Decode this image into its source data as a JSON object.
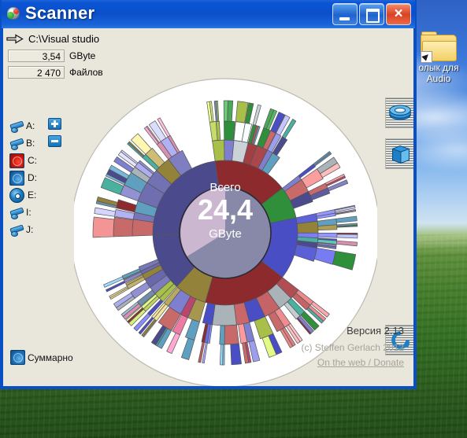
{
  "desktop": {
    "shortcut": {
      "label": "олык для\nAudio",
      "icon": "folder-shortcut-icon"
    }
  },
  "window": {
    "title": "Scanner",
    "icon": "globe-icon",
    "buttons": {
      "minimize": "minimize-button",
      "maximize": "maximize-button",
      "close": "×"
    }
  },
  "path": {
    "icon": "arrow-right-icon",
    "value": "C:\\Visual studio"
  },
  "stats": [
    {
      "value": "3,54",
      "unit": "GByte"
    },
    {
      "value": "2 470",
      "unit": "Файлов"
    }
  ],
  "drives": [
    {
      "letter": "A:",
      "type": "floppy"
    },
    {
      "letter": "B:",
      "type": "floppy"
    },
    {
      "letter": "C:",
      "type": "hd-red"
    },
    {
      "letter": "D:",
      "type": "hd-blue"
    },
    {
      "letter": "E:",
      "type": "cd"
    },
    {
      "letter": "I:",
      "type": "floppy"
    },
    {
      "letter": "J:",
      "type": "floppy"
    }
  ],
  "zoom_buttons": {
    "plus": "+",
    "minus": "−"
  },
  "tools": [
    {
      "name": "recycle-bin-button",
      "icon": "recycle-bin-icon"
    },
    {
      "name": "folder-up-button",
      "icon": "folder-icon"
    },
    {
      "name": "refresh-button",
      "icon": "refresh-icon"
    }
  ],
  "summary": {
    "label": "Суммарно",
    "icon": "hd-blue-icon"
  },
  "footer": {
    "version": "Версия 2.13",
    "copyright": "(c) Steffen Gerlach 2012",
    "link": "On the web / Donate"
  },
  "chart_data": {
    "type": "pie",
    "title": "",
    "center_label_top": "Всего",
    "center_label_value": "24,4",
    "center_label_unit": "GByte",
    "total_gbyte": 24.4,
    "legend_position": "none",
    "rings": [
      {
        "ring": 0,
        "r_inner": 0,
        "r_outer": 58,
        "note": "center disc"
      },
      {
        "ring": 1,
        "r_inner": 58,
        "r_outer": 92
      },
      {
        "ring": 2,
        "r_inner": 92,
        "r_outer": 118
      },
      {
        "ring": 3,
        "r_inner": 118,
        "r_outer": 142
      },
      {
        "ring": 4,
        "r_inner": 142,
        "r_outer": 168
      }
    ],
    "series": [
      {
        "name": "slate-blue",
        "start_angle": 268,
        "end_angle": 352,
        "value": 5.7,
        "color": "#4a4a8c"
      },
      {
        "name": "dark-red",
        "start_angle": 352,
        "end_angle": 52,
        "value": 4.7,
        "color": "#8d2a2e"
      },
      {
        "name": "green",
        "start_angle": 52,
        "end_angle": 78,
        "value": 1.8,
        "color": "#2f8f3a"
      },
      {
        "name": "royal-blue",
        "start_angle": 78,
        "end_angle": 128,
        "value": 3.4,
        "color": "#4a4ec4"
      },
      {
        "name": "dark-red-2",
        "start_angle": 128,
        "end_angle": 196,
        "value": 4.6,
        "color": "#8d2a2e"
      },
      {
        "name": "olive",
        "start_angle": 196,
        "end_angle": 222,
        "value": 1.8,
        "color": "#93823a"
      },
      {
        "name": "slate-blue-2",
        "start_angle": 222,
        "end_angle": 268,
        "value": 3.1,
        "color": "#4a4a8c"
      }
    ],
    "palette": [
      "#4a4a8c",
      "#8d2a2e",
      "#2f8f3a",
      "#4a4ec4",
      "#93823a",
      "#6f8fa8",
      "#4ab0a0",
      "#b8466f",
      "#aab3b8",
      "#cbd3d8",
      "#7f7fd0",
      "#a8bf4a",
      "#c96a6a",
      "#d98fb0",
      "#5f9fc0"
    ],
    "background": "#ffffff",
    "outer_circle_radius": 197
  }
}
